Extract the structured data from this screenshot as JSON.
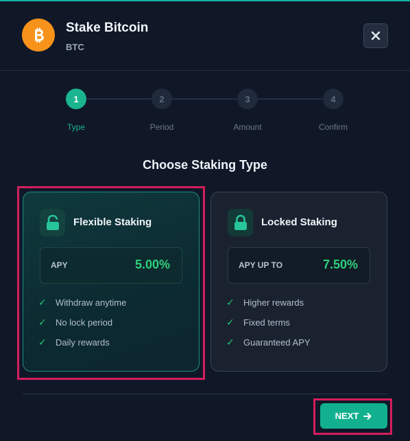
{
  "header": {
    "title": "Stake Bitcoin",
    "subtitle": "BTC",
    "coin_icon": "bitcoin-icon",
    "close_icon": "close-icon"
  },
  "stepper": {
    "steps": [
      {
        "number": "1",
        "label": "Type",
        "active": true
      },
      {
        "number": "2",
        "label": "Period",
        "active": false
      },
      {
        "number": "3",
        "label": "Amount",
        "active": false
      },
      {
        "number": "4",
        "label": "Confirm",
        "active": false
      }
    ]
  },
  "section_title": "Choose Staking Type",
  "options": [
    {
      "title": "Flexible Staking",
      "icon": "unlocked-icon",
      "apy_label": "APY",
      "apy_value": "5.00%",
      "features": [
        "Withdraw anytime",
        "No lock period",
        "Daily rewards"
      ],
      "selected": true
    },
    {
      "title": "Locked Staking",
      "icon": "lock-icon",
      "apy_label": "APY UP TO",
      "apy_value": "7.50%",
      "features": [
        "Higher rewards",
        "Fixed terms",
        "Guaranteed APY"
      ],
      "selected": false
    }
  ],
  "footer": {
    "next_label": "NEXT",
    "next_icon": "arrow-right-icon"
  },
  "colors": {
    "accent": "#1ab58e",
    "apy": "#2fd07b",
    "highlight": "#d51e5c",
    "bitcoin": "#f7931a"
  }
}
